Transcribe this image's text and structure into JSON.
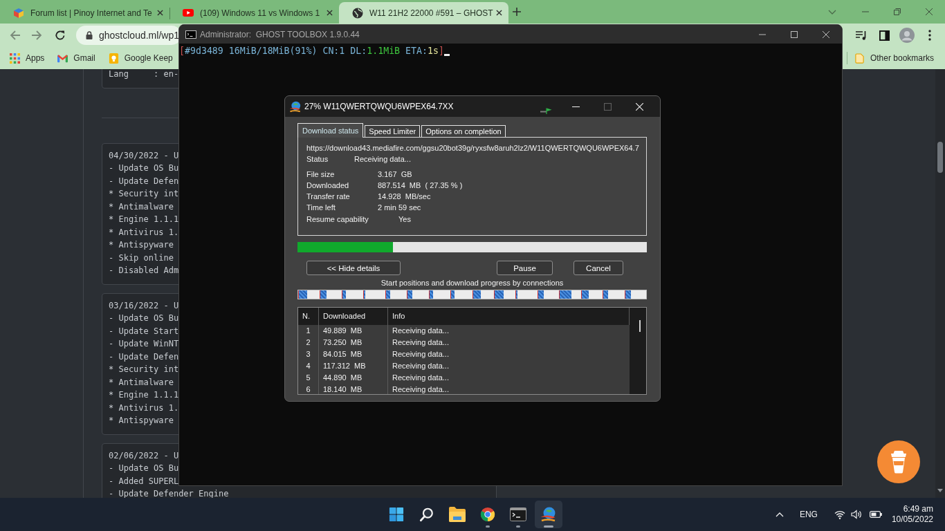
{
  "browser": {
    "tabs": [
      {
        "kind": "forum",
        "title": "Forum list | Pinoy Internet and Te",
        "selected": false
      },
      {
        "kind": "video",
        "title": "(109) Windows 11 vs Windows 1",
        "selected": false
      },
      {
        "kind": "web",
        "title": "W11 21H2 22000 #591 – GHOST",
        "selected": true
      }
    ],
    "address": {
      "url": "ghostcloud.ml/wp1"
    },
    "bookmarks": [
      {
        "kind": "apps",
        "label": "Apps"
      },
      {
        "kind": "mail",
        "label": "Gmail"
      },
      {
        "kind": "notes",
        "label": "Google Keep"
      }
    ],
    "other_bookmarks": "Other bookmarks"
  },
  "page": {
    "header_block": {
      "lines": [
        "Lang     : en-"
      ]
    },
    "changelog": [
      {
        "lines": [
          "04/30/2022 - U",
          "- Update OS Bu",
          "- Update Defen",
          "* Security int",
          "* Antimalware",
          "* Engine 1.1.1",
          "* Antivirus 1.",
          "* Antispyware",
          "- Skip online",
          "- Disabled Adm"
        ]
      },
      {
        "lines": [
          "03/16/2022 - U",
          "- Update OS Bu",
          "- Update Start",
          "- Update WinNT",
          "- Update Defen",
          "* Security int",
          "* Antimalware",
          "* Engine 1.1.1",
          "* Antivirus 1.",
          "* Antispyware"
        ]
      },
      {
        "lines": [
          "02/06/2022 - U",
          "- Update OS Bu",
          "- Added SUPERL",
          "- Update Defender Engine"
        ]
      }
    ]
  },
  "terminal": {
    "title": "Administrator:  GHOST TOOLBOX 1.9.0.44",
    "output": [
      {
        "kind": "bracket",
        "text": "["
      },
      {
        "kind": "plain",
        "text": "#9d3489 16MiB/18MiB(91%) CN:1 DL:"
      },
      {
        "kind": "speed",
        "text": "1.1MiB"
      },
      {
        "kind": "plain",
        "text": " ETA:"
      },
      {
        "kind": "eta",
        "text": "1s"
      },
      {
        "kind": "bracket",
        "text": "]"
      }
    ]
  },
  "download_dialog": {
    "title": "27% W11QWERTQWQU6WPEX64.7XX",
    "maximize_disabled": true,
    "tabs": [
      {
        "label": "Download status",
        "selected": true
      },
      {
        "label": "Speed Limiter",
        "selected": false
      },
      {
        "label": "Options on completion",
        "selected": false
      }
    ],
    "url": "https://download43.mediafire.com/ggsu20bot39g/ryxsfw8aruh2lz2/W11QWERTQWQU6WPEX64.7",
    "status": {
      "label": "Status",
      "value": "Receiving data..."
    },
    "details": [
      {
        "label": "File size",
        "value": "3.167  GB"
      },
      {
        "label": "Downloaded",
        "value": "887.514  MB  ( 27.35 % )"
      },
      {
        "label": "Transfer rate",
        "value": "14.928  MB/sec"
      },
      {
        "label": "Time left",
        "value": "2 min 59 sec"
      }
    ],
    "resume": {
      "label": "Resume capability",
      "value": "Yes"
    },
    "progress": {
      "level": 0.2735
    },
    "buttons": [
      {
        "label": "<< Hide details"
      },
      {
        "label": "Pause"
      },
      {
        "label": "Cancel"
      }
    ],
    "connections_caption": "Start positions and download progress by connections",
    "connections": [
      {
        "level": 0.38
      },
      {
        "level": 0.28
      },
      {
        "level": 0.17
      },
      {
        "level": 0.05
      },
      {
        "level": 0.22
      },
      {
        "level": 0.24
      },
      {
        "level": 0.18
      },
      {
        "level": 0.17
      },
      {
        "level": 0.38
      },
      {
        "level": 0.43
      },
      {
        "level": 0.05
      },
      {
        "level": 0.27
      },
      {
        "level": 0.54
      },
      {
        "level": 0.35
      },
      {
        "level": 0.22
      },
      {
        "level": 0.28
      }
    ],
    "table": {
      "columns": [
        "N.",
        "Downloaded",
        "Info"
      ],
      "rows": [
        [
          "1",
          "49.889  MB",
          "Receiving data..."
        ],
        [
          "2",
          "73.250  MB",
          "Receiving data..."
        ],
        [
          "3",
          "84.015  MB",
          "Receiving data..."
        ],
        [
          "4",
          "117.312  MB",
          "Receiving data..."
        ],
        [
          "5",
          "44.890  MB",
          "Receiving data..."
        ],
        [
          "6",
          "18.140  MB",
          "Receiving data..."
        ]
      ]
    }
  },
  "taskbar": {
    "apps": [
      {
        "kind": "start",
        "running": false,
        "selected": false
      },
      {
        "kind": "search",
        "running": false,
        "selected": false
      },
      {
        "kind": "files",
        "running": false,
        "selected": false
      },
      {
        "kind": "browser",
        "running": true,
        "selected": false
      },
      {
        "kind": "terminal",
        "running": true,
        "selected": false
      },
      {
        "kind": "downloader",
        "running": true,
        "selected": true
      }
    ],
    "language": "ENG",
    "time": "6:49 am",
    "date": "10/05/2022"
  }
}
